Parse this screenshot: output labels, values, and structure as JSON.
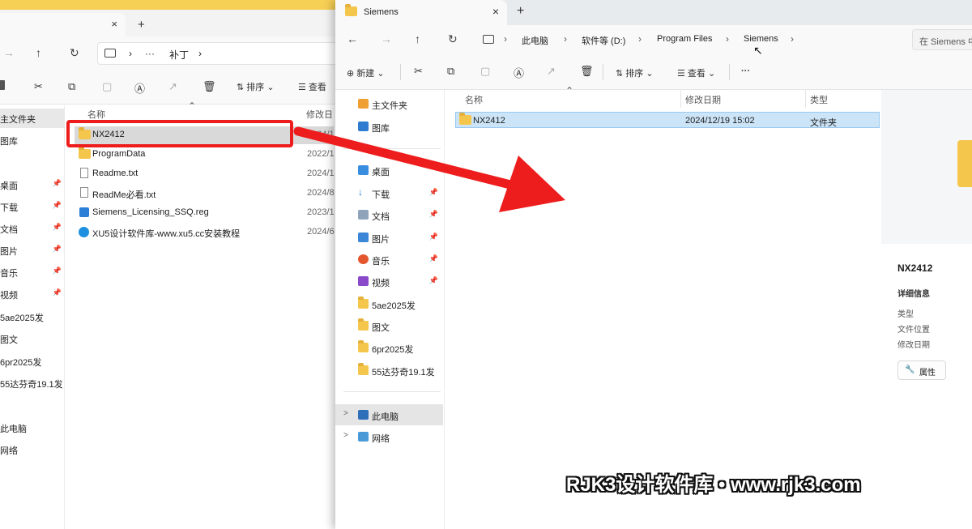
{
  "left_window": {
    "tab_close": "×",
    "new_tab": "+",
    "nav": {
      "forward": "→",
      "up": "↑",
      "refresh": "↻"
    },
    "address": {
      "more": "···",
      "sep": "›",
      "folder": "补丁",
      "trail": "›"
    },
    "toolbar": {
      "sort": "排序",
      "view": "查看"
    },
    "sidebar": [
      {
        "label": "主文件夹"
      },
      {
        "label": "图库"
      },
      {
        "label": "桌面",
        "pin": "📌"
      },
      {
        "label": "下载",
        "pin": "📌"
      },
      {
        "label": "文档",
        "pin": "📌"
      },
      {
        "label": "图片",
        "pin": "📌"
      },
      {
        "label": "音乐",
        "pin": "📌"
      },
      {
        "label": "视频",
        "pin": "📌"
      },
      {
        "label": "5ae2025发"
      },
      {
        "label": "图文"
      },
      {
        "label": "6pr2025发"
      },
      {
        "label": "55达芬奇19.1发"
      },
      {
        "label": "此电脑"
      },
      {
        "label": "网络"
      }
    ],
    "columns": {
      "name": "名称",
      "modified": "修改日"
    },
    "files": [
      {
        "name": "NX2412",
        "date": "2024/1"
      },
      {
        "name": "ProgramData",
        "date": "2022/1"
      },
      {
        "name": "Readme.txt",
        "date": "2024/1"
      },
      {
        "name": "ReadMe必看.txt",
        "date": "2024/8"
      },
      {
        "name": "Siemens_Licensing_SSQ.reg",
        "date": "2023/1"
      },
      {
        "name": "XU5设计软件库-www.xu5.cc安装教程",
        "date": "2024/6"
      }
    ]
  },
  "right_window": {
    "tab_title": "Siemens",
    "tab_close": "×",
    "new_tab": "+",
    "nav": {
      "back": "←",
      "forward": "→",
      "up": "↑",
      "refresh": "↻"
    },
    "breadcrumb": [
      "此电脑",
      "软件等 (D:)",
      "Program Files",
      "Siemens"
    ],
    "crumb_sep": "›",
    "search_placeholder": "在 Siemens 中",
    "toolbar": {
      "new": "新建",
      "sort": "排序",
      "view": "查看",
      "more": "···"
    },
    "sidebar": [
      {
        "label": "主文件夹"
      },
      {
        "label": "图库"
      },
      {
        "label": "桌面"
      },
      {
        "label": "下载",
        "pin": "📌"
      },
      {
        "label": "文档",
        "pin": "📌"
      },
      {
        "label": "图片",
        "pin": "📌"
      },
      {
        "label": "音乐",
        "pin": "📌"
      },
      {
        "label": "视频",
        "pin": "📌"
      },
      {
        "label": "5ae2025发"
      },
      {
        "label": "图文"
      },
      {
        "label": "6pr2025发"
      },
      {
        "label": "55达芬奇19.1发"
      },
      {
        "label": "此电脑"
      },
      {
        "label": "网络"
      }
    ],
    "expand": ">",
    "columns": {
      "name": "名称",
      "modified": "修改日期",
      "type": "类型"
    },
    "files": [
      {
        "name": "NX2412",
        "date": "2024/12/19 15:02",
        "type": "文件夹"
      }
    ],
    "details": {
      "title": "NX2412",
      "section": "详细信息",
      "props": [
        "类型",
        "文件位置",
        "修改日期"
      ],
      "button": "属性"
    }
  },
  "watermark": "RJK3设计软件库 • www.rjk3.com",
  "colors": {
    "arrow": "#ee1d1d",
    "highlight_box": "#ee1d1d",
    "selection": "#cce4f7",
    "folder": "#f5c64c"
  }
}
